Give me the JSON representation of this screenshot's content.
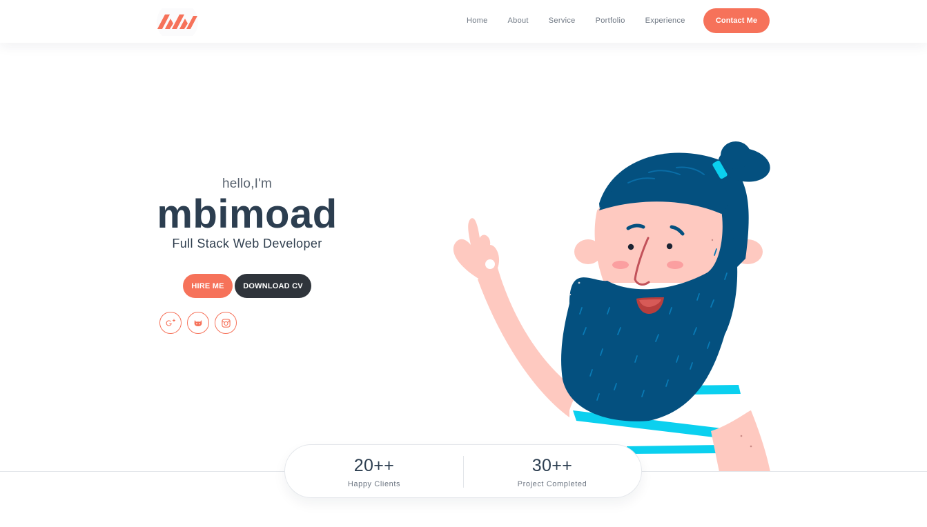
{
  "header": {
    "logo_icon": "mbimoad-logo-icon",
    "nav": [
      {
        "label": "Home"
      },
      {
        "label": "About"
      },
      {
        "label": "Service"
      },
      {
        "label": "Portfolio"
      },
      {
        "label": "Experience"
      }
    ],
    "contact_label": "Contact Me"
  },
  "hero": {
    "greeting": "hello,I'm",
    "name": "mbimoad",
    "role": "Full Stack Web Developer",
    "hire_label": "HIRE ME",
    "download_label": "DOWNLOAD CV",
    "social": [
      {
        "icon": "google-plus-icon",
        "glyph": "g+"
      },
      {
        "icon": "github-icon",
        "glyph": "gh"
      },
      {
        "icon": "instagram-icon",
        "glyph": "ig"
      }
    ],
    "illustration_icon": "bearded-man-waving-illustration"
  },
  "stats": [
    {
      "value": "20++",
      "label": "Happy Clients"
    },
    {
      "value": "30++",
      "label": "Project Completed"
    }
  ],
  "colors": {
    "accent": "#f6725a",
    "dark": "#2f343b",
    "heading": "#2c3e50",
    "hair": "#04507f",
    "skin": "#fec9c0",
    "stripe": "#0bd0ef"
  }
}
